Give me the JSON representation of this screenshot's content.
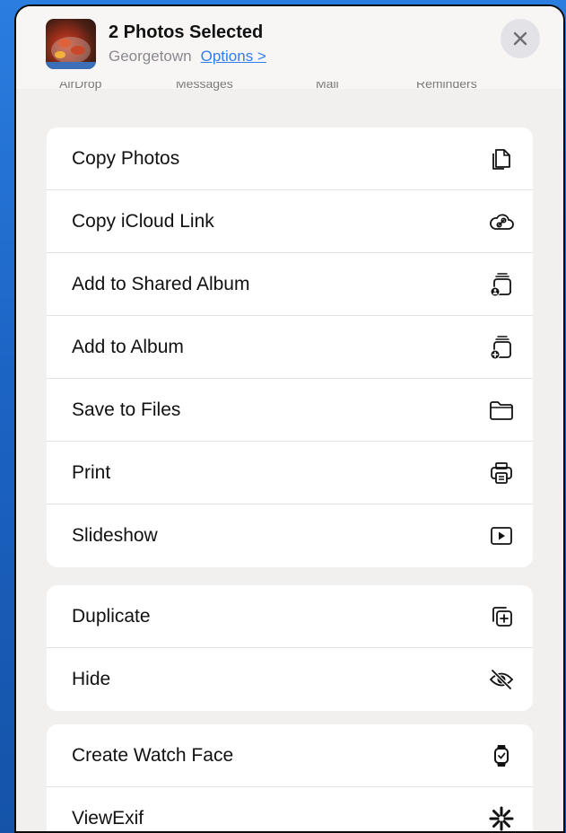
{
  "header": {
    "title": "2 Photos Selected",
    "location": "Georgetown",
    "options_label": "Options >"
  },
  "share_strip": [
    "AirDrop",
    "Messages",
    "Mail",
    "Reminders"
  ],
  "groups": [
    {
      "items": [
        {
          "label": "Copy Photos",
          "icon": "copy-icon"
        },
        {
          "label": "Copy iCloud Link",
          "icon": "cloud-link-icon"
        },
        {
          "label": "Add to Shared Album",
          "icon": "shared-album-icon"
        },
        {
          "label": "Add to Album",
          "icon": "add-album-icon"
        },
        {
          "label": "Save to Files",
          "icon": "folder-icon"
        },
        {
          "label": "Print",
          "icon": "printer-icon"
        },
        {
          "label": "Slideshow",
          "icon": "play-icon"
        }
      ]
    },
    {
      "items": [
        {
          "label": "Duplicate",
          "icon": "duplicate-icon"
        },
        {
          "label": "Hide",
          "icon": "eye-slash-icon"
        }
      ]
    },
    {
      "items": [
        {
          "label": "Create Watch Face",
          "icon": "watch-icon"
        },
        {
          "label": "ViewExif",
          "icon": "asterisk-icon"
        }
      ]
    }
  ],
  "colors": {
    "accent": "#2f7ef0",
    "background": "#1f6fd1",
    "sheet": "#f2f0ef"
  }
}
